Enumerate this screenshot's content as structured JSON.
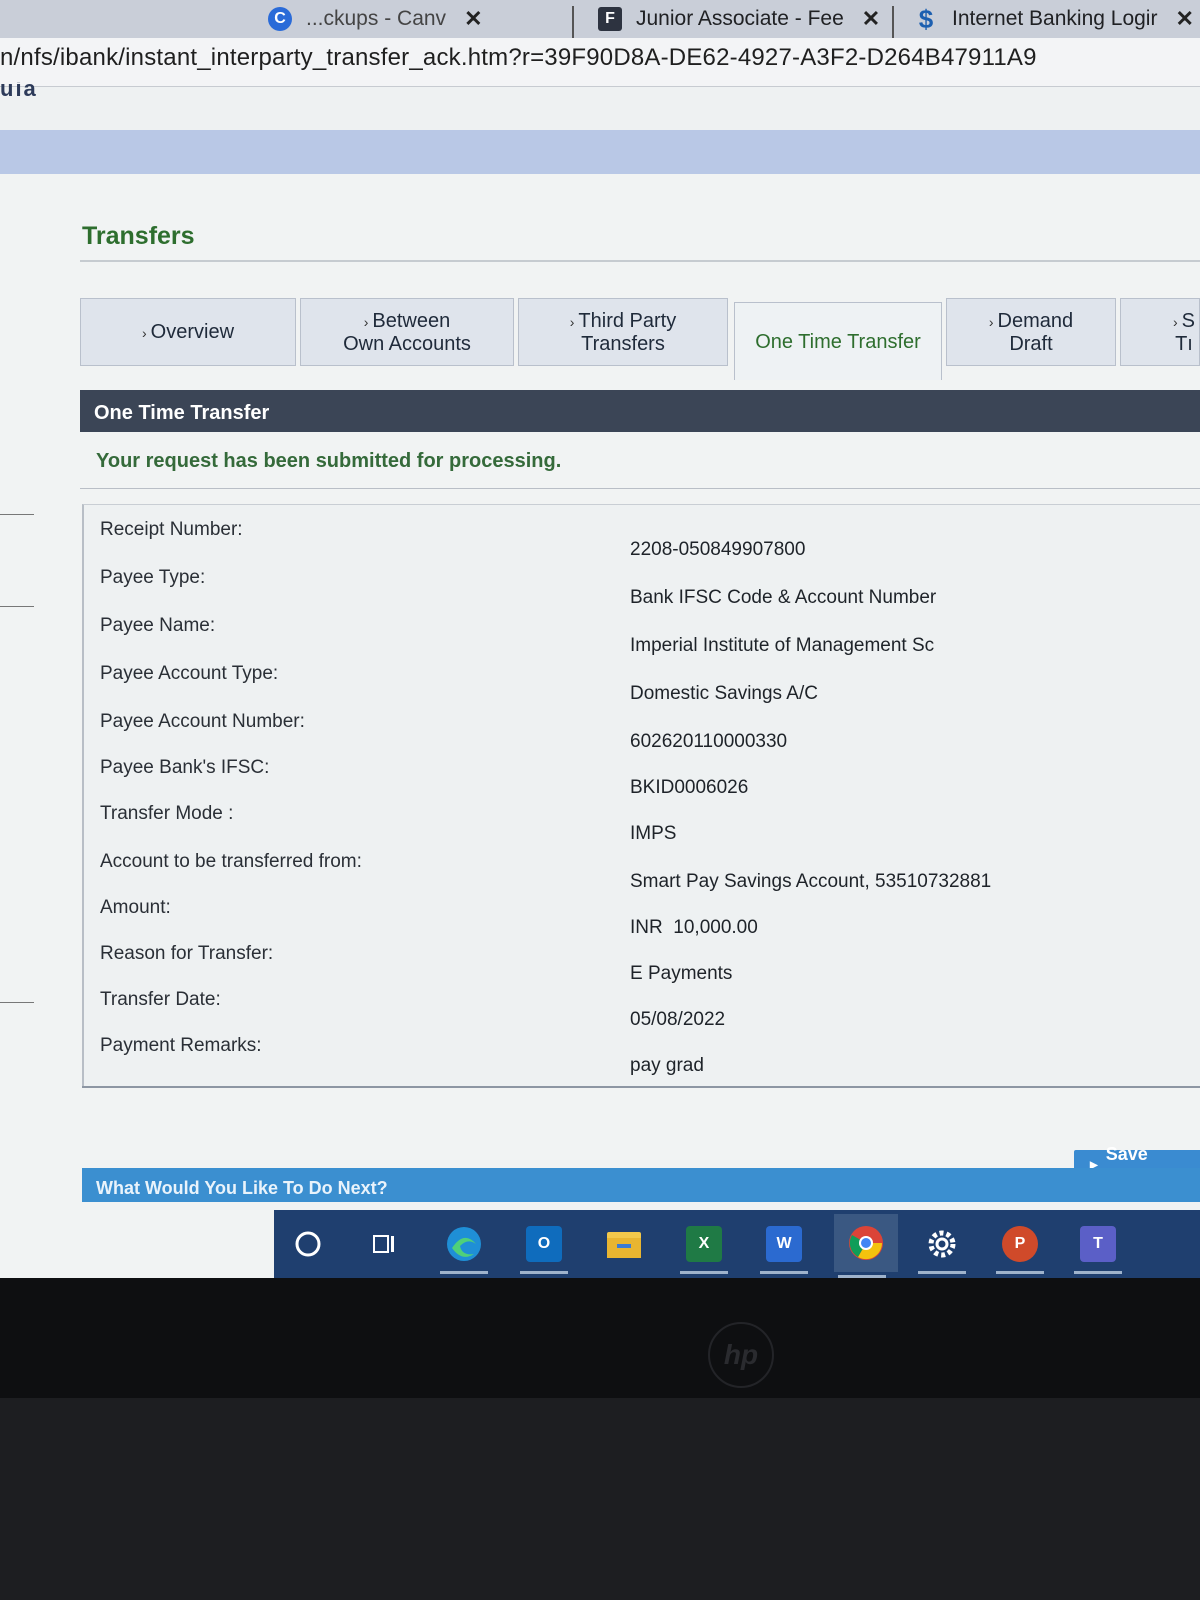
{
  "browser": {
    "tabs": [
      {
        "title": "...ckups - Canv",
        "favicon": "canva-icon"
      },
      {
        "title": "Junior Associate - Fee",
        "favicon": "f-icon"
      },
      {
        "title": "Internet Banking Logir",
        "favicon": "bank-logo-icon"
      }
    ],
    "url": "n/nfs/ibank/instant_interparty_transfer_ack.htm?r=39F90D8A-DE62-4927-A3F2-D264B47911A9"
  },
  "site": {
    "logo_fragment": "uia"
  },
  "page": {
    "title": "Transfers",
    "nav_tabs": [
      {
        "label_line1": "Overview",
        "label_line2": ""
      },
      {
        "label_line1": "Between",
        "label_line2": "Own Accounts"
      },
      {
        "label_line1": "Third Party",
        "label_line2": "Transfers"
      },
      {
        "label_line1": "One Time Transfer",
        "label_line2": ""
      },
      {
        "label_line1": "Demand",
        "label_line2": "Draft"
      },
      {
        "label_line1": "S",
        "label_line2": "Tı"
      }
    ],
    "section_title": "One Time Transfer",
    "status_message": "Your request has been submitted for processing.",
    "details": [
      {
        "label": "Receipt Number:",
        "value": "2208-050849907800"
      },
      {
        "label": "Payee Type:",
        "value": "Bank IFSC Code & Account Number"
      },
      {
        "label": "Payee Name:",
        "value": "Imperial Institute of Management Sc"
      },
      {
        "label": "Payee Account Type:",
        "value": "Domestic Savings A/C"
      },
      {
        "label": "Payee Account Number:",
        "value": "602620110000330"
      },
      {
        "label": "Payee Bank's IFSC:",
        "value": "BKID0006026"
      },
      {
        "label": "Transfer Mode :",
        "value": "IMPS"
      },
      {
        "label": "Account to be transferred from:",
        "value": "Smart Pay Savings Account, 53510732881"
      },
      {
        "label": "Amount:",
        "value": "INR  10,000.00"
      },
      {
        "label": "Reason for Transfer:",
        "value": "E Payments"
      },
      {
        "label": "Transfer Date:",
        "value": "05/08/2022"
      },
      {
        "label": "Payment Remarks:",
        "value": "pay grad"
      }
    ],
    "save_payee_label": "Save Payee",
    "next_section_title": "What Would You Like To Do Next?"
  },
  "taskbar": {
    "icons": [
      "search-icon",
      "task-view-icon",
      "edge-icon",
      "outlook-icon",
      "file-explorer-icon",
      "excel-icon",
      "word-icon",
      "chrome-icon",
      "settings-icon",
      "powerpoint-icon",
      "teams-icon"
    ],
    "letters": {
      "outlook": "O",
      "excel": "X",
      "word": "W",
      "powerpoint": "P",
      "teams": "T"
    }
  },
  "colors": {
    "accent_green": "#2e6e2e",
    "header_dark": "#3b4556",
    "button_blue": "#3a8bd1",
    "taskbar": "#1f3f6f"
  }
}
